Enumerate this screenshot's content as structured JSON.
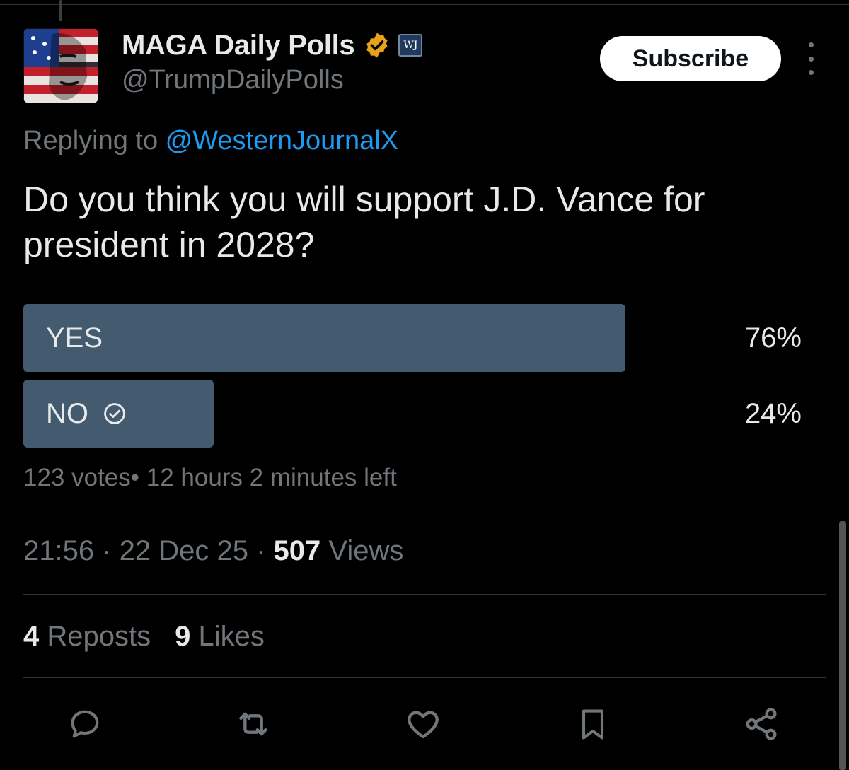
{
  "author": {
    "display_name": "MAGA Daily Polls",
    "handle": "@TrumpDailyPolls",
    "avatar_icon": "flag-face-avatar",
    "verified_badge_color": "#e8a317",
    "affiliate_badge_text": "WJ"
  },
  "header": {
    "subscribe_label": "Subscribe"
  },
  "reply": {
    "prefix": "Replying to ",
    "mention": "@WesternJournalX"
  },
  "tweet": {
    "text": "Do you think you will support J.D. Vance for president in 2028?"
  },
  "poll": {
    "options": [
      {
        "label": "YES",
        "percent_text": "76%",
        "percent": 76,
        "selected": false
      },
      {
        "label": "NO",
        "percent_text": "24%",
        "percent": 24,
        "selected": true
      }
    ],
    "meta": "123 votes• 12 hours 2 minutes left",
    "bar_color": "#435a6f"
  },
  "timestamp": {
    "time": "21:56",
    "sep1": " · ",
    "date": "22 Dec 25",
    "sep2": " · ",
    "views_count": "507",
    "views_label": " Views"
  },
  "stats": {
    "reposts_count": "4",
    "reposts_label": " Reposts",
    "likes_count": "9",
    "likes_label": " Likes"
  },
  "actions": [
    {
      "icon": "reply-icon"
    },
    {
      "icon": "repost-icon"
    },
    {
      "icon": "like-icon"
    },
    {
      "icon": "bookmark-icon"
    },
    {
      "icon": "share-icon"
    }
  ],
  "colors": {
    "background": "#000000",
    "text_primary": "#e7e9ea",
    "text_secondary": "#71767b",
    "link": "#1d9bf0",
    "divider": "#2f3336"
  }
}
